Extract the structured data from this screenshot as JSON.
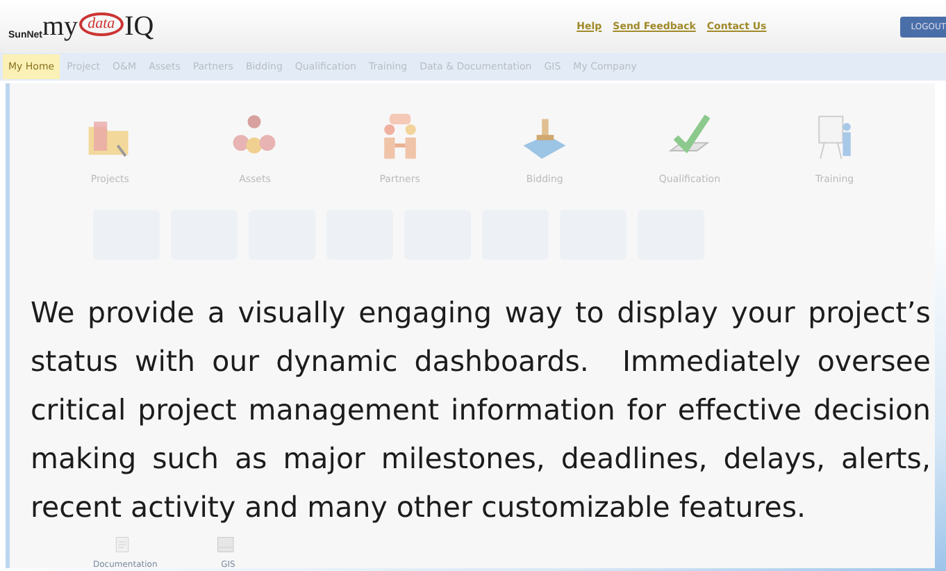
{
  "logo": {
    "company": "SunNet",
    "prefix": "my",
    "emblem": "data",
    "suffix": "IQ"
  },
  "header_links": [
    "Help",
    "Send Feedback",
    "Contact Us"
  ],
  "logout_button": "LOGOUT",
  "tabs": [
    {
      "label": "My Home",
      "selected": true
    },
    {
      "label": "Project",
      "selected": false
    },
    {
      "label": "O&M",
      "selected": false
    },
    {
      "label": "Assets",
      "selected": false
    },
    {
      "label": "Partners",
      "selected": false
    },
    {
      "label": "Bidding",
      "selected": false
    },
    {
      "label": "Qualification",
      "selected": false
    },
    {
      "label": "Training",
      "selected": false
    },
    {
      "label": "Data & Documentation",
      "selected": false
    },
    {
      "label": "GIS",
      "selected": false
    },
    {
      "label": "My Company",
      "selected": false
    }
  ],
  "modules": [
    {
      "label": "Projects",
      "kind": "folder"
    },
    {
      "label": "Assets",
      "kind": "people"
    },
    {
      "label": "Partners",
      "kind": "handshake"
    },
    {
      "label": "Bidding",
      "kind": "stamp"
    },
    {
      "label": "Qualification",
      "kind": "check"
    },
    {
      "label": "Training",
      "kind": "board"
    }
  ],
  "bottom_modules": [
    {
      "label": "Documentation",
      "kind": "docs"
    },
    {
      "label": "GIS",
      "kind": "map"
    }
  ],
  "overlay_text": "We provide a visually engaging way to display your project’s status with our dynamic dashboards.  Immediately oversee critical project management information for effective decision making such as major milestones, deadlines, delays, alerts, recent activity and many other customizable features."
}
